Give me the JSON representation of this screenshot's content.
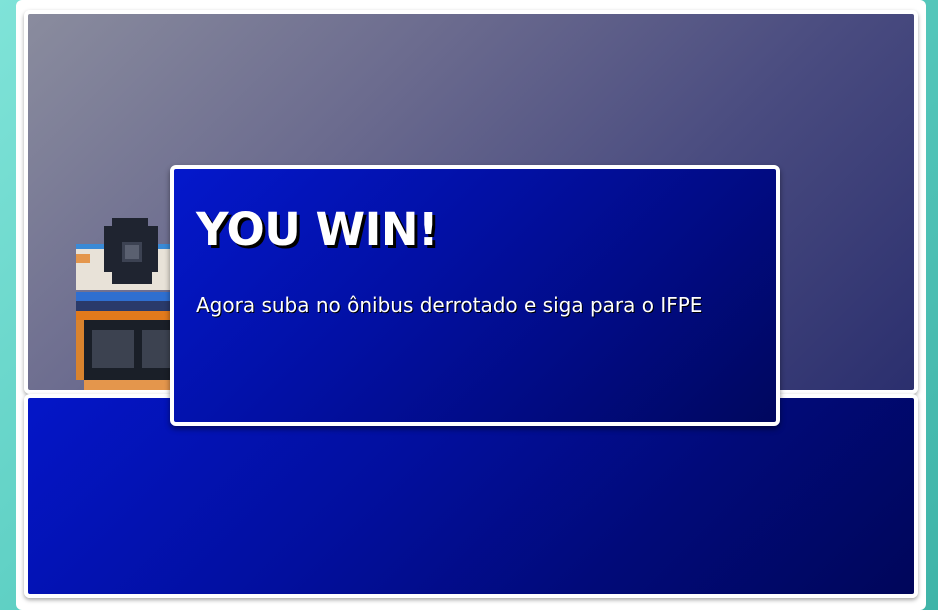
{
  "dialog": {
    "title": "YOU WIN!",
    "message": "Agora suba no ônibus derrotado e siga para o IFPE"
  },
  "scene": {
    "sprite": "bus-front-icon"
  },
  "colors": {
    "outer_background": "#5fd0c4",
    "dialog_background": "#0210a4",
    "panel_border": "#ffffff",
    "scene_background": "#6a6a8e",
    "title_text": "#ffffff"
  }
}
